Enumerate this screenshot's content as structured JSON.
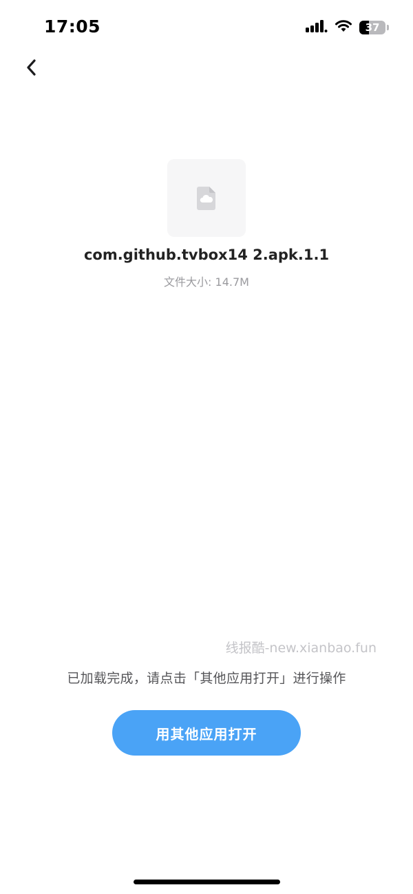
{
  "status_bar": {
    "time": "17:05",
    "battery_level": "37",
    "battery_fraction": 0.37,
    "icons": [
      "cellular-signal-icon",
      "wifi-icon",
      "battery-icon"
    ]
  },
  "nav": {
    "back_icon": "chevron-left-icon"
  },
  "file": {
    "icon": "cloud-file-icon",
    "name": "com.github.tvbox14 2.apk.1.1",
    "size_label": "文件大小: 14.7M"
  },
  "watermark": {
    "text": "线报酷-new.xianbao.fun"
  },
  "hint": {
    "text": "已加载完成，请点击「其他应用打开」进行操作"
  },
  "actions": {
    "open_with_other_app_label": "用其他应用打开"
  },
  "colors": {
    "primary_button": "#4aa3f6",
    "tile_background": "#f6f6f7"
  }
}
